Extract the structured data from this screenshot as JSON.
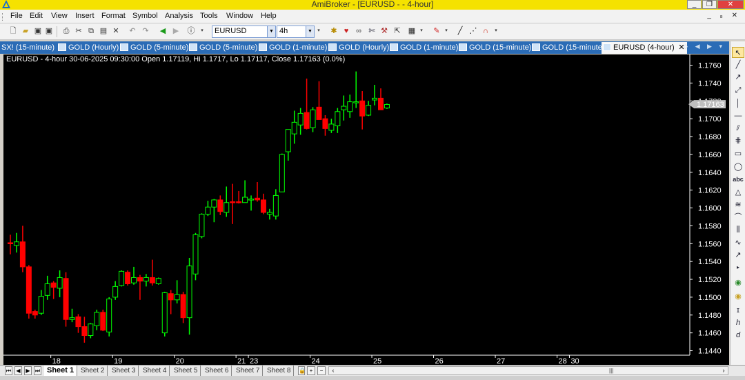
{
  "window": {
    "title": "AmiBroker - [EURUSD -  - 4-hour]",
    "controls": [
      "_",
      "❐",
      "✕"
    ]
  },
  "menu": [
    "File",
    "Edit",
    "View",
    "Insert",
    "Format",
    "Symbol",
    "Analysis",
    "Tools",
    "Window",
    "Help"
  ],
  "mdi_controls": "_ ₈ ✕",
  "toolbar": {
    "symbol_value": "EURUSD",
    "interval_value": "4h"
  },
  "tabs": [
    {
      "label": "SX! (15-minute)",
      "active": false
    },
    {
      "label": "GOLD (Hourly)",
      "active": false
    },
    {
      "label": "GOLD (5-minute)",
      "active": false
    },
    {
      "label": "GOLD (5-minute)",
      "active": false
    },
    {
      "label": "GOLD (1-minute)",
      "active": false
    },
    {
      "label": "GOLD (Hourly)",
      "active": false
    },
    {
      "label": "GOLD (1-minute)",
      "active": false
    },
    {
      "label": "GOLD (15-minute)",
      "active": false
    },
    {
      "label": "GOLD (15-minute)",
      "active": false
    },
    {
      "label": "EURUSD (4-hour)",
      "active": true
    }
  ],
  "chart_header": "EURUSD - 4-hour 30-06-2025 09:30:00 Open 1.17119, Hi 1.1717, Lo 1.17117, Close 1.17163 (0.0%)",
  "chart_data": {
    "type": "candlestick",
    "symbol": "EURUSD",
    "interval": "4-hour",
    "ylim": [
      1.1435,
      1.1772
    ],
    "yticks": [
      "1.1760",
      "1.1740",
      "1.1720",
      "1.1700",
      "1.1680",
      "1.1660",
      "1.1640",
      "1.1620",
      "1.1600",
      "1.1580",
      "1.1560",
      "1.1540",
      "1.1520",
      "1.1500",
      "1.1480",
      "1.1460",
      "1.1440"
    ],
    "last_price": "1.17163",
    "xlabels": [
      {
        "label": "18",
        "bar": 7
      },
      {
        "label": "19",
        "bar": 17
      },
      {
        "label": "20",
        "bar": 27
      },
      {
        "label": "21",
        "bar": 37
      },
      {
        "label": "23",
        "bar": 39
      },
      {
        "label": "24",
        "bar": 49
      },
      {
        "label": "25",
        "bar": 59
      },
      {
        "label": "26",
        "bar": 69
      },
      {
        "label": "27",
        "bar": 79
      },
      {
        "label": "28",
        "bar": 89
      },
      {
        "label": "30",
        "bar": 91
      }
    ],
    "up_color": "#00ff00",
    "down_color": "#ff0000",
    "candles": [
      {
        "o": 1.1561,
        "h": 1.157,
        "l": 1.1548,
        "c": 1.156
      },
      {
        "o": 1.1558,
        "h": 1.1572,
        "l": 1.155,
        "c": 1.1562
      },
      {
        "o": 1.1562,
        "h": 1.158,
        "l": 1.1528,
        "c": 1.1534
      },
      {
        "o": 1.1534,
        "h": 1.1536,
        "l": 1.1476,
        "c": 1.1482
      },
      {
        "o": 1.1484,
        "h": 1.1486,
        "l": 1.1476,
        "c": 1.148
      },
      {
        "o": 1.1482,
        "h": 1.1508,
        "l": 1.148,
        "c": 1.1501
      },
      {
        "o": 1.1502,
        "h": 1.1524,
        "l": 1.1497,
        "c": 1.1515
      },
      {
        "o": 1.1516,
        "h": 1.1518,
        "l": 1.1498,
        "c": 1.1511
      },
      {
        "o": 1.151,
        "h": 1.153,
        "l": 1.15,
        "c": 1.1522
      },
      {
        "o": 1.1521,
        "h": 1.1528,
        "l": 1.1467,
        "c": 1.1475
      },
      {
        "o": 1.1475,
        "h": 1.1487,
        "l": 1.1472,
        "c": 1.1477
      },
      {
        "o": 1.1478,
        "h": 1.1481,
        "l": 1.146,
        "c": 1.1467
      },
      {
        "o": 1.1467,
        "h": 1.1478,
        "l": 1.1449,
        "c": 1.1457
      },
      {
        "o": 1.1457,
        "h": 1.1471,
        "l": 1.1454,
        "c": 1.147
      },
      {
        "o": 1.1468,
        "h": 1.1486,
        "l": 1.1463,
        "c": 1.1483
      },
      {
        "o": 1.1483,
        "h": 1.1486,
        "l": 1.1462,
        "c": 1.1463
      },
      {
        "o": 1.1461,
        "h": 1.15,
        "l": 1.1456,
        "c": 1.1498
      },
      {
        "o": 1.15,
        "h": 1.1518,
        "l": 1.1497,
        "c": 1.1512
      },
      {
        "o": 1.1513,
        "h": 1.153,
        "l": 1.1512,
        "c": 1.1529
      },
      {
        "o": 1.1528,
        "h": 1.153,
        "l": 1.1513,
        "c": 1.1515
      },
      {
        "o": 1.1516,
        "h": 1.1534,
        "l": 1.1514,
        "c": 1.1522
      },
      {
        "o": 1.1522,
        "h": 1.1525,
        "l": 1.1497,
        "c": 1.1518
      },
      {
        "o": 1.1518,
        "h": 1.1526,
        "l": 1.1512,
        "c": 1.1522
      },
      {
        "o": 1.1522,
        "h": 1.1542,
        "l": 1.1513,
        "c": 1.1516
      },
      {
        "o": 1.1515,
        "h": 1.1522,
        "l": 1.1514,
        "c": 1.1521
      },
      {
        "o": 1.146,
        "h": 1.1506,
        "l": 1.1456,
        "c": 1.1505
      },
      {
        "o": 1.1504,
        "h": 1.1508,
        "l": 1.1481,
        "c": 1.1497
      },
      {
        "o": 1.1497,
        "h": 1.1519,
        "l": 1.1493,
        "c": 1.1503
      },
      {
        "o": 1.1503,
        "h": 1.1506,
        "l": 1.1471,
        "c": 1.1477
      },
      {
        "o": 1.1477,
        "h": 1.1544,
        "l": 1.1458,
        "c": 1.1535
      },
      {
        "o": 1.1526,
        "h": 1.1572,
        "l": 1.1519,
        "c": 1.157
      },
      {
        "o": 1.1568,
        "h": 1.1594,
        "l": 1.1566,
        "c": 1.1593
      },
      {
        "o": 1.1593,
        "h": 1.1608,
        "l": 1.1591,
        "c": 1.1601
      },
      {
        "o": 1.1601,
        "h": 1.161,
        "l": 1.1584,
        "c": 1.1609
      },
      {
        "o": 1.1609,
        "h": 1.1614,
        "l": 1.1592,
        "c": 1.1596
      },
      {
        "o": 1.1595,
        "h": 1.1624,
        "l": 1.159,
        "c": 1.1606
      },
      {
        "o": 1.1607,
        "h": 1.1627,
        "l": 1.1582,
        "c": 1.1606
      },
      {
        "o": 1.1607,
        "h": 1.1619,
        "l": 1.1605,
        "c": 1.1606
      },
      {
        "o": 1.1606,
        "h": 1.1631,
        "l": 1.1606,
        "c": 1.1612
      },
      {
        "o": 1.1609,
        "h": 1.1614,
        "l": 1.1597,
        "c": 1.161
      },
      {
        "o": 1.1611,
        "h": 1.1629,
        "l": 1.1607,
        "c": 1.1609
      },
      {
        "o": 1.1609,
        "h": 1.1616,
        "l": 1.1593,
        "c": 1.1595
      },
      {
        "o": 1.1593,
        "h": 1.1599,
        "l": 1.1587,
        "c": 1.1595
      },
      {
        "o": 1.1591,
        "h": 1.1621,
        "l": 1.1587,
        "c": 1.1614
      },
      {
        "o": 1.1618,
        "h": 1.1661,
        "l": 1.1618,
        "c": 1.166
      },
      {
        "o": 1.1663,
        "h": 1.1685,
        "l": 1.1653,
        "c": 1.1688
      },
      {
        "o": 1.1683,
        "h": 1.1709,
        "l": 1.1672,
        "c": 1.1696
      },
      {
        "o": 1.1693,
        "h": 1.1712,
        "l": 1.1682,
        "c": 1.1706
      },
      {
        "o": 1.1707,
        "h": 1.1745,
        "l": 1.1688,
        "c": 1.1689
      },
      {
        "o": 1.169,
        "h": 1.1713,
        "l": 1.1685,
        "c": 1.171
      },
      {
        "o": 1.1713,
        "h": 1.1742,
        "l": 1.17,
        "c": 1.1699
      },
      {
        "o": 1.17,
        "h": 1.1704,
        "l": 1.1681,
        "c": 1.1689
      },
      {
        "o": 1.1687,
        "h": 1.17,
        "l": 1.1684,
        "c": 1.1694
      },
      {
        "o": 1.1692,
        "h": 1.1712,
        "l": 1.1684,
        "c": 1.1708
      },
      {
        "o": 1.171,
        "h": 1.1726,
        "l": 1.1698,
        "c": 1.1714
      },
      {
        "o": 1.1708,
        "h": 1.1727,
        "l": 1.1701,
        "c": 1.1719
      },
      {
        "o": 1.1719,
        "h": 1.1753,
        "l": 1.1712,
        "c": 1.1719
      },
      {
        "o": 1.172,
        "h": 1.1731,
        "l": 1.1688,
        "c": 1.1703
      },
      {
        "o": 1.1704,
        "h": 1.172,
        "l": 1.1703,
        "c": 1.1715
      },
      {
        "o": 1.1721,
        "h": 1.1738,
        "l": 1.1715,
        "c": 1.1723
      },
      {
        "o": 1.1723,
        "h": 1.1734,
        "l": 1.171,
        "c": 1.171
      },
      {
        "o": 1.1712,
        "h": 1.1717,
        "l": 1.1711,
        "c": 1.1716
      }
    ]
  },
  "sheets": [
    "Sheet 1",
    "Sheet 2",
    "Sheet 3",
    "Sheet 4",
    "Sheet 5",
    "Sheet 6",
    "Sheet 7",
    "Sheet 8"
  ],
  "drawing_tools": [
    "pointer-icon",
    "line-icon",
    "ray-icon",
    "trendline-icon",
    "vertical-line-icon",
    "horizontal-line-icon",
    "channel-icon",
    "fibonacci-icon",
    "rectangle-icon",
    "ellipse-icon",
    "text-icon",
    "triangle-icon",
    "gann-icon",
    "arc-icon",
    "fan-icon",
    "wave-icon",
    "arrow-icon",
    "cycle-icon",
    "color-icon",
    "fill-icon",
    "thickness-icon",
    "italic-icon",
    "delete-icon"
  ]
}
